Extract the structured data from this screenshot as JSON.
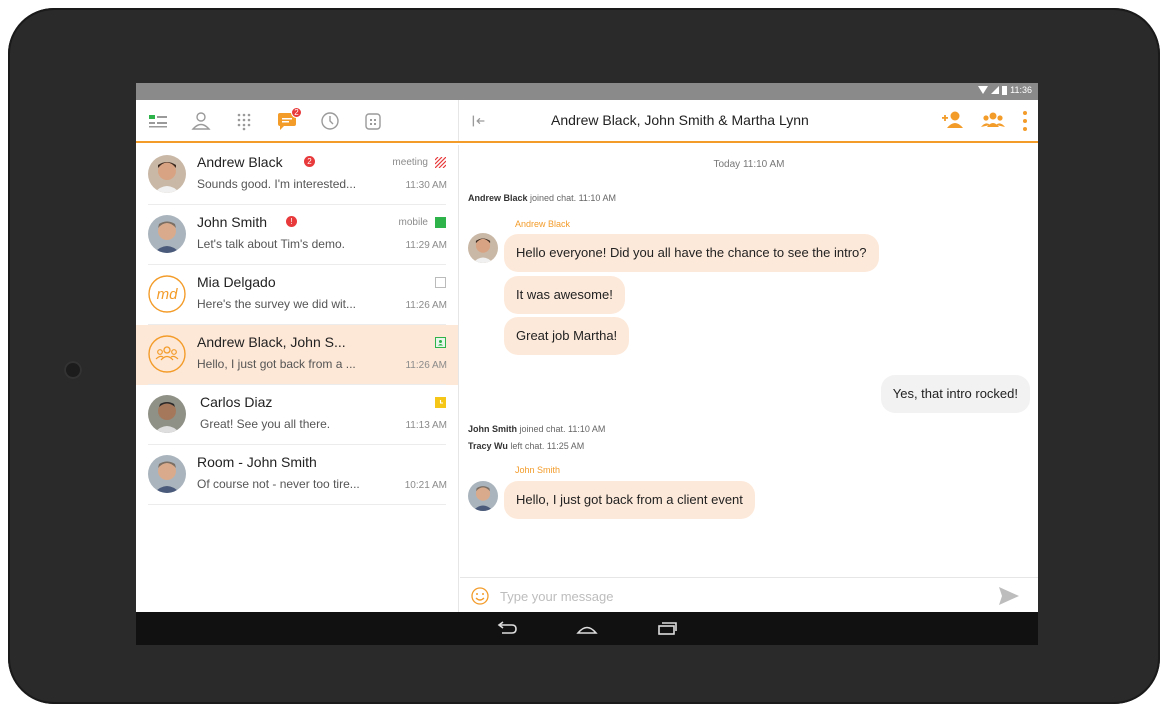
{
  "status_bar": {
    "time": "11:36"
  },
  "header": {
    "title": "Andrew Black, John Smith & Martha Lynn",
    "chat_badge": "2"
  },
  "colors": {
    "accent": "#f39c2a",
    "unread": "#e8393b",
    "active_row": "#fde7d6",
    "incoming_bubble": "#fde9da"
  },
  "conversations": [
    {
      "name": "Andrew Black",
      "preview": "Sounds good. I'm interested...",
      "status": "meeting",
      "time": "11:30 AM",
      "unread": true,
      "unread_count": "2",
      "presence": "busy-meeting"
    },
    {
      "name": "John Smith",
      "preview": "Let's talk about Tim's demo.",
      "status": "mobile",
      "time": "11:29 AM",
      "unread": true,
      "unread_count": "!",
      "presence": "available"
    },
    {
      "name": "Mia Delgado",
      "preview": "Here's the survey we did wit...",
      "status": "",
      "time": "11:26 AM",
      "unread": false,
      "presence": "offline",
      "initials": "md"
    },
    {
      "name": "Andrew Black, John S...",
      "preview": "Hello, I just got back from a ...",
      "status": "",
      "time": "11:26 AM",
      "unread": false,
      "presence": "group"
    },
    {
      "name": "Carlos Diaz",
      "preview": "Great! See you all there.",
      "status": "",
      "time": "11:13 AM",
      "unread": false,
      "presence": "away"
    },
    {
      "name": "Room - John Smith",
      "preview": "Of course not - never too tire...",
      "status": "",
      "time": "10:21 AM",
      "unread": false,
      "presence": "none"
    }
  ],
  "chat": {
    "date_divider": "Today 11:10 AM",
    "events": [
      {
        "who": "Andrew Black",
        "text": "joined chat. 11:10 AM"
      },
      {
        "who": "John Smith",
        "text": "joined chat. 11:10 AM"
      },
      {
        "who": "Tracy Wu",
        "text": "left chat. 11:25 AM"
      }
    ],
    "messages": [
      {
        "sender": "Andrew Black",
        "text": "Hello everyone! Did you all have the chance to see the intro?"
      },
      {
        "sender": "",
        "text": "It was awesome!"
      },
      {
        "sender": "",
        "text": "Great job Martha!"
      },
      {
        "sender": "me",
        "text": "Yes, that intro rocked!"
      },
      {
        "sender": "John Smith",
        "text": "Hello, I just got back from a client event"
      }
    ]
  },
  "compose": {
    "placeholder": "Type your message",
    "value": ""
  }
}
